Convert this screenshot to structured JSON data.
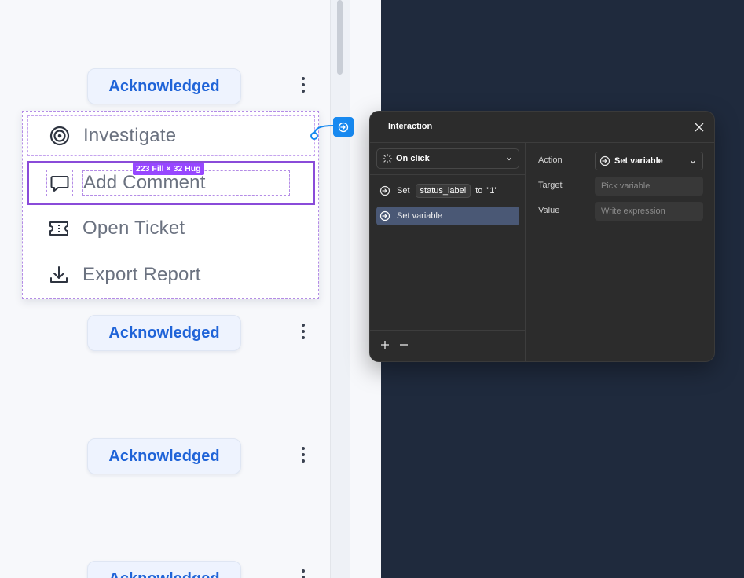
{
  "canvas": {
    "ack_label": "Acknowledged",
    "menu": {
      "items": [
        {
          "label": "Investigate",
          "icon": "target-icon"
        },
        {
          "label": "Add Comment",
          "icon": "comment-icon"
        },
        {
          "label": "Open Ticket",
          "icon": "ticket-icon"
        },
        {
          "label": "Export Report",
          "icon": "download-icon"
        }
      ],
      "selected_size_badge": "223 Fill × 32 Hug"
    }
  },
  "interaction_panel": {
    "title": "Interaction",
    "trigger": "On click",
    "actions": [
      {
        "prefix": "Set",
        "variable": "status_label",
        "connector": "to",
        "value": "\"1\""
      },
      {
        "label": "Set variable"
      }
    ],
    "properties": {
      "action_label": "Action",
      "action_value": "Set variable",
      "target_label": "Target",
      "target_placeholder": "Pick variable",
      "value_label": "Value",
      "value_placeholder": "Write expression"
    }
  },
  "colors": {
    "accent_blue": "#2064d8",
    "selection_purple": "#8a4bd9",
    "badge_purple": "#9747ff",
    "panel_bg": "#2c2c2c",
    "selected_row": "#4a5875",
    "prototype_blue": "#1789f0"
  }
}
